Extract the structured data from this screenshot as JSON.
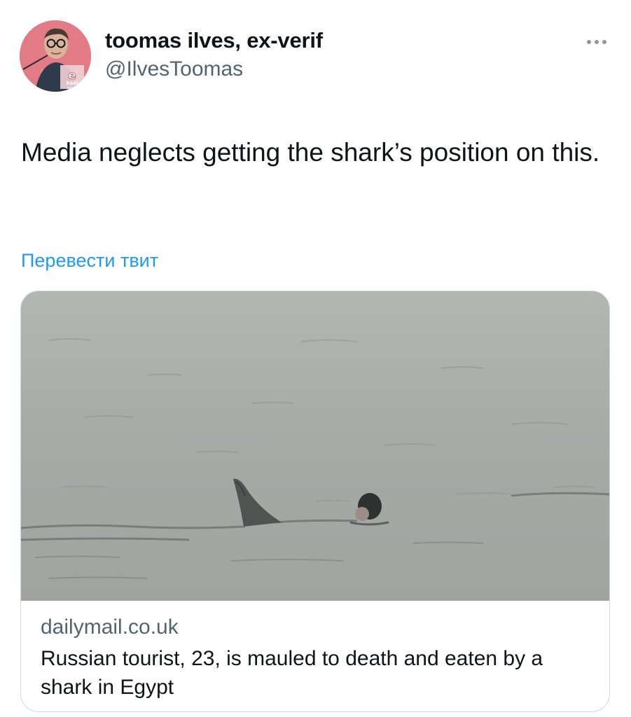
{
  "tweet": {
    "author": {
      "display_name": "toomas ilves, ex-verif",
      "handle": "@IlvesToomas",
      "avatar_badge_letter": "e",
      "avatar_badge_text_1": "hääl",
      "avatar_badge_text_2": "antud"
    },
    "more_icon": "ellipsis-icon",
    "text": "Media neglects getting the shark’s position on this.",
    "translate_label": "Перевести твит",
    "link_card": {
      "domain": "dailymail.co.uk",
      "title": "Russian tourist, 23, is mauled to death and eaten by a shark in Egypt"
    }
  },
  "colors": {
    "link_blue": "#1d9bf0",
    "secondary_text": "#536471",
    "primary_text": "#0f1419",
    "border": "#cfd9de",
    "avatar_background": "#e27b86"
  }
}
